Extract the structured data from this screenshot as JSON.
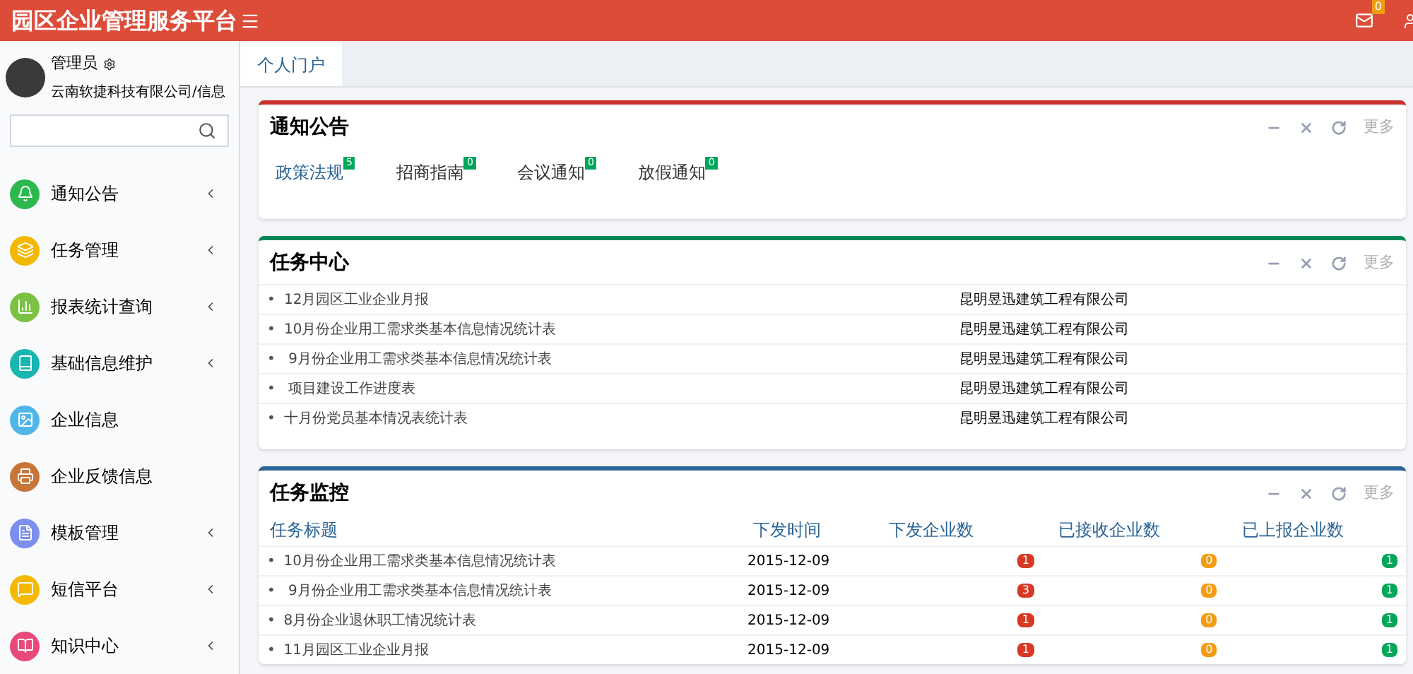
{
  "header": {
    "title": "园区企业管理服务平台",
    "mail_badge": "0"
  },
  "user": {
    "name": "管理员",
    "org": "云南软捷科技有限公司/信息"
  },
  "menu": [
    {
      "label": "通知公告",
      "color": "#2db84d",
      "has_children": true
    },
    {
      "label": "任务管理",
      "color": "#f5b800",
      "has_children": true
    },
    {
      "label": "报表统计查询",
      "color": "#7cc242",
      "has_children": true
    },
    {
      "label": "基础信息维护",
      "color": "#19b5b0",
      "has_children": true
    },
    {
      "label": "企业信息",
      "color": "#4fb6e8",
      "has_children": false
    },
    {
      "label": "企业反馈信息",
      "color": "#c8753a",
      "has_children": false
    },
    {
      "label": "模板管理",
      "color": "#7b8fef",
      "has_children": true
    },
    {
      "label": "短信平台",
      "color": "#f5b800",
      "has_children": true
    },
    {
      "label": "知识中心",
      "color": "#e8497a",
      "has_children": true
    }
  ],
  "tabs": [
    {
      "label": "个人门户",
      "selected": true
    }
  ],
  "notice_box": {
    "title": "通知公告",
    "more": "更多",
    "tabs": [
      {
        "label": "政策法规",
        "count": "5",
        "selected": true
      },
      {
        "label": "招商指南",
        "count": "0",
        "selected": false
      },
      {
        "label": "会议通知",
        "count": "0",
        "selected": false
      },
      {
        "label": "放假通知",
        "count": "0",
        "selected": false
      }
    ]
  },
  "task_box": {
    "title": "任务中心",
    "more": "更多",
    "rows": [
      {
        "bullet": "•",
        "title": "12月园区工业企业月报",
        "company": "昆明昱迅建筑工程有限公司"
      },
      {
        "bullet": "•",
        "title": "10月份企业用工需求类基本信息情况统计表",
        "company": "昆明昱迅建筑工程有限公司"
      },
      {
        "bullet": "•",
        "title": " 9月份企业用工需求类基本信息情况统计表",
        "company": "昆明昱迅建筑工程有限公司"
      },
      {
        "bullet": "•",
        "title": " 项目建设工作进度表",
        "company": "昆明昱迅建筑工程有限公司"
      },
      {
        "bullet": "•",
        "title": "十月份党员基本情况表统计表",
        "company": "昆明昱迅建筑工程有限公司"
      }
    ]
  },
  "monitor_box": {
    "title": "任务监控",
    "more": "更多",
    "columns": [
      "任务标题",
      "下发时间",
      "下发企业数",
      "已接收企业数",
      "已上报企业数"
    ],
    "rows": [
      {
        "bullet": "•",
        "title": "10月份企业用工需求类基本信息情况统计表",
        "date": "2015-12-09",
        "counts": [
          {
            "text": "1",
            "color": "#d73925"
          },
          {
            "text": "0",
            "color": "#f39c12"
          },
          {
            "text": "1",
            "color": "#00a65a"
          }
        ]
      },
      {
        "bullet": "•",
        "title": " 9月份企业用工需求类基本信息情况统计表",
        "date": "2015-12-09",
        "counts": [
          {
            "text": "3",
            "color": "#d73925"
          },
          {
            "text": "0",
            "color": "#f39c12"
          },
          {
            "text": "1",
            "color": "#00a65a"
          }
        ]
      },
      {
        "bullet": "•",
        "title": "8月份企业退休职工情况统计表",
        "date": "2015-12-09",
        "counts": [
          {
            "text": "1",
            "color": "#d73925"
          },
          {
            "text": "0",
            "color": "#f39c12"
          },
          {
            "text": "1",
            "color": "#00a65a"
          }
        ]
      },
      {
        "bullet": "•",
        "title": "11月园区工业企业月报",
        "date": "2015-12-09",
        "counts": [
          {
            "text": "1",
            "color": "#d73925"
          },
          {
            "text": "0",
            "color": "#f39c12"
          },
          {
            "text": "1",
            "color": "#00a65a"
          }
        ]
      }
    ]
  }
}
